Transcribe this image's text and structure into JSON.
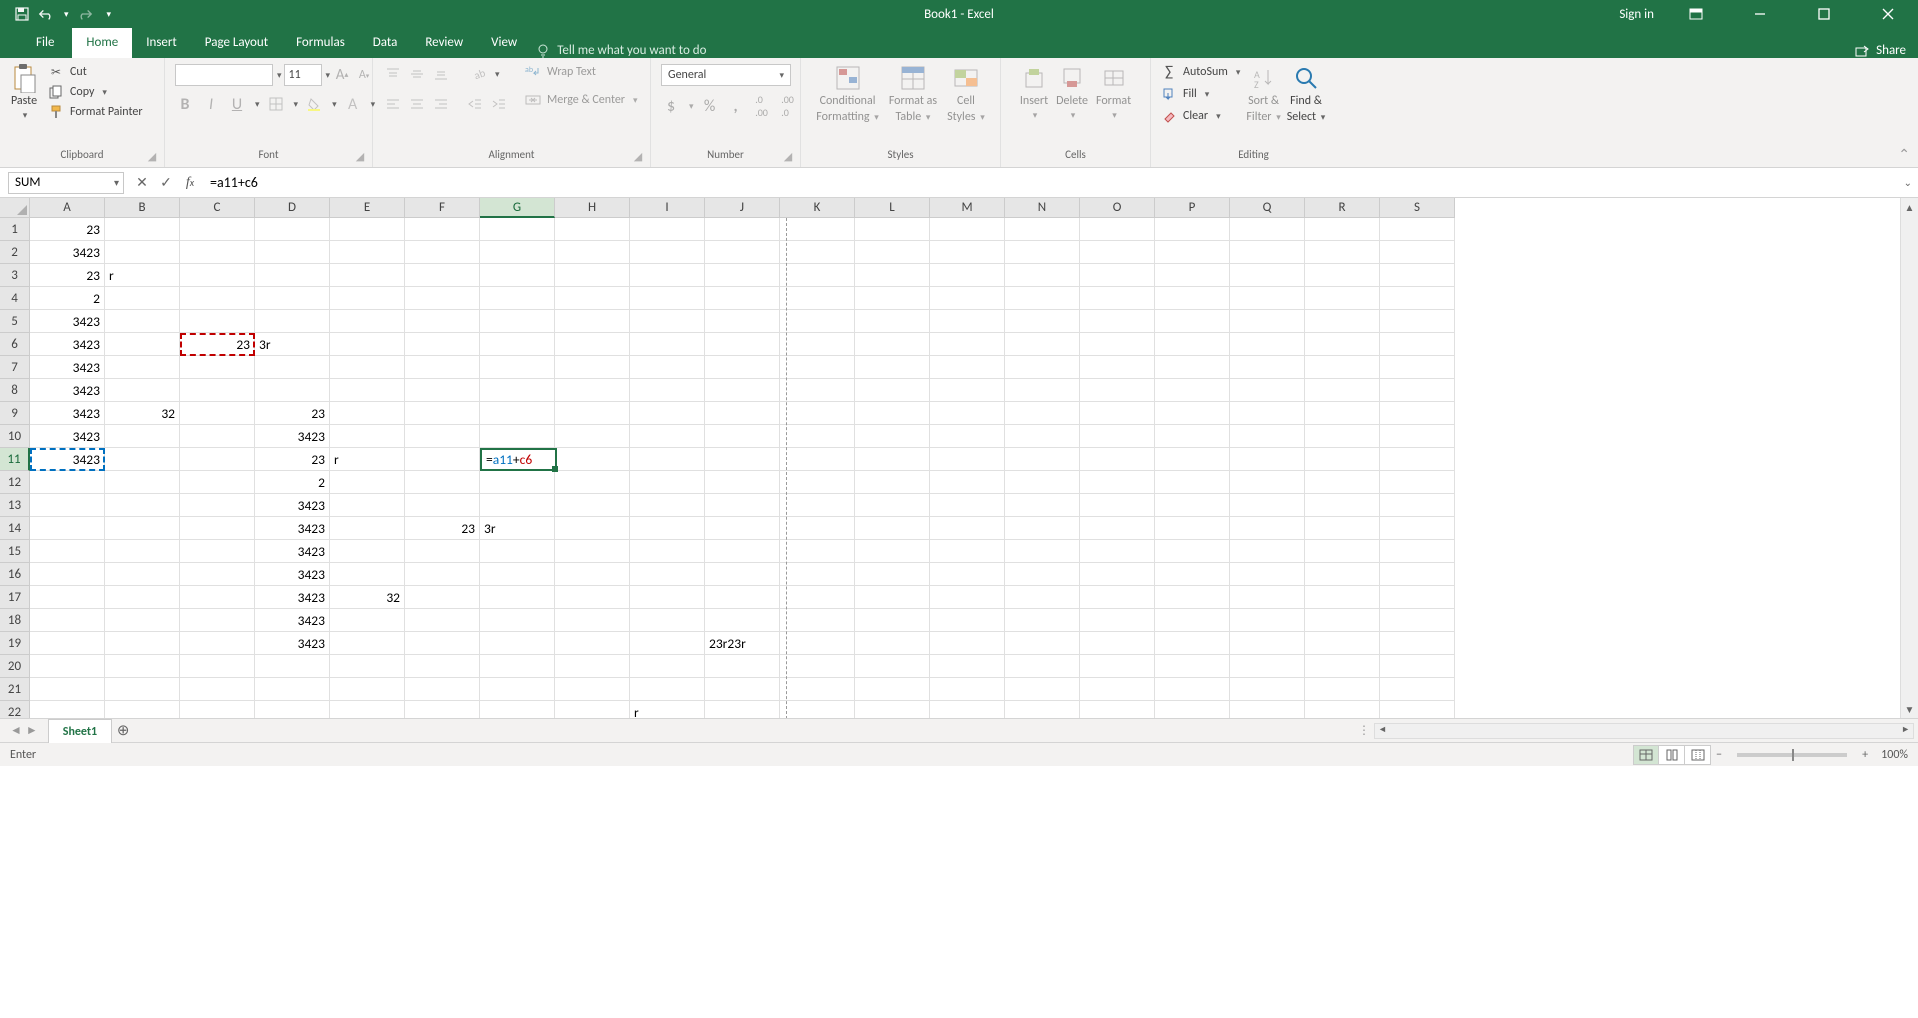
{
  "title": "Book1  -  Excel",
  "signin": "Sign in",
  "qat": {
    "save": "save",
    "undo": "undo",
    "redo": "redo"
  },
  "tabs": {
    "file": "File",
    "home": "Home",
    "insert": "Insert",
    "pagelayout": "Page Layout",
    "formulas": "Formulas",
    "data": "Data",
    "review": "Review",
    "view": "View",
    "tell": "Tell me what you want to do",
    "share": "Share"
  },
  "ribbon": {
    "clipboard": {
      "label": "Clipboard",
      "paste": "Paste",
      "cut": "Cut",
      "copy": "Copy",
      "formatpainter": "Format Painter"
    },
    "font": {
      "label": "Font",
      "name": "",
      "size": "11"
    },
    "alignment": {
      "label": "Alignment",
      "wrap": "Wrap Text",
      "merge": "Merge & Center"
    },
    "number": {
      "label": "Number",
      "format": "General"
    },
    "styles": {
      "label": "Styles",
      "cond1": "Conditional",
      "cond2": "Formatting",
      "fmt1": "Format as",
      "fmt2": "Table",
      "cell1": "Cell",
      "cell2": "Styles"
    },
    "cells": {
      "label": "Cells",
      "insert": "Insert",
      "delete": "Delete",
      "format": "Format"
    },
    "editing": {
      "label": "Editing",
      "autosum": "AutoSum",
      "fill": "Fill",
      "clear": "Clear",
      "sort1": "Sort &",
      "sort2": "Filter",
      "find1": "Find &",
      "find2": "Select"
    }
  },
  "formula": {
    "namebox": "SUM",
    "text": "=a11+c6",
    "editText": "=a11+c6",
    "ref1": "a11",
    "ref2": "c6"
  },
  "columns": [
    "A",
    "B",
    "C",
    "D",
    "E",
    "F",
    "G",
    "H",
    "I",
    "J",
    "K",
    "L",
    "M",
    "N",
    "O",
    "P",
    "Q",
    "R",
    "S"
  ],
  "rows": [
    "1",
    "2",
    "3",
    "4",
    "5",
    "6",
    "7",
    "8",
    "9",
    "10",
    "11",
    "12",
    "13",
    "14",
    "15",
    "16",
    "17",
    "18",
    "19",
    "20",
    "21",
    "22"
  ],
  "activeCol": "G",
  "activeRow": "11",
  "cells": {
    "A1": "23",
    "A2": "3423",
    "A3": "23",
    "B3": "r",
    "A4": "2",
    "A5": "3423",
    "A6": "3423",
    "C6": "23",
    "D6": "3r",
    "A7": "3423",
    "A8": "3423",
    "A9": "3423",
    "B9": "32",
    "D9": "23",
    "A10": "3423",
    "D10": "3423",
    "A11": "3423",
    "D11": "23",
    "E11": "r",
    "A12": "",
    "D12": "2",
    "D13": "3423",
    "D14": "3423",
    "F14": "23",
    "G14": "3r",
    "D15": "3423",
    "D16": "3423",
    "D17": "3423",
    "E17": "32",
    "D18": "3423",
    "D19": "3423",
    "J19": "23r23r",
    "I22": "r"
  },
  "numericCells": [
    "A1",
    "A2",
    "A3",
    "A4",
    "A5",
    "A6",
    "A7",
    "A8",
    "A9",
    "A10",
    "A11",
    "C6",
    "B9",
    "D9",
    "D10",
    "D11",
    "D12",
    "D13",
    "D14",
    "D15",
    "D16",
    "D17",
    "D18",
    "D19",
    "E17",
    "F14"
  ],
  "sheet": {
    "name": "Sheet1"
  },
  "status": {
    "mode": "Enter",
    "zoom": "100%"
  }
}
